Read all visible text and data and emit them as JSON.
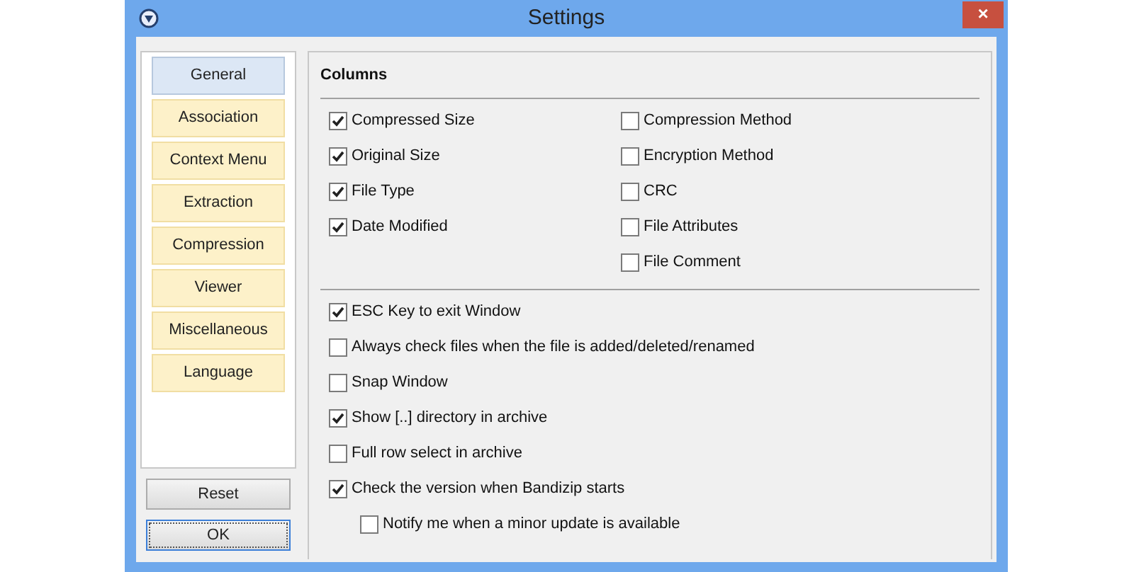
{
  "window": {
    "title": "Settings",
    "close": "×"
  },
  "sidebar": {
    "items": [
      {
        "label": "General",
        "selected": true
      },
      {
        "label": "Association",
        "selected": false
      },
      {
        "label": "Context Menu",
        "selected": false
      },
      {
        "label": "Extraction",
        "selected": false
      },
      {
        "label": "Compression",
        "selected": false
      },
      {
        "label": "Viewer",
        "selected": false
      },
      {
        "label": "Miscellaneous",
        "selected": false
      },
      {
        "label": "Language",
        "selected": false
      }
    ],
    "buttons": [
      {
        "label": "Reset",
        "focused": false
      },
      {
        "label": "OK",
        "focused": true
      }
    ]
  },
  "columns": {
    "title": "Columns",
    "left": [
      {
        "label": "Compressed Size",
        "checked": true
      },
      {
        "label": "Original Size",
        "checked": true
      },
      {
        "label": "File Type",
        "checked": true
      },
      {
        "label": "Date Modified",
        "checked": true
      }
    ],
    "right": [
      {
        "label": "Compression Method",
        "checked": false
      },
      {
        "label": "Encryption Method",
        "checked": false
      },
      {
        "label": "CRC",
        "checked": false
      },
      {
        "label": "File Attributes",
        "checked": false
      },
      {
        "label": "File Comment",
        "checked": false
      }
    ]
  },
  "options": [
    {
      "label": "ESC Key to exit Window",
      "checked": true
    },
    {
      "label": "Always check files when the file is added/deleted/renamed",
      "checked": false
    },
    {
      "label": "Snap Window",
      "checked": false
    },
    {
      "label": "Show [..] directory in archive",
      "checked": true
    },
    {
      "label": "Full row select in archive",
      "checked": false
    },
    {
      "label": "Check the version when Bandizip starts",
      "checked": true,
      "children": [
        {
          "label": "Notify me when a minor update is available",
          "checked": false
        }
      ]
    }
  ]
}
